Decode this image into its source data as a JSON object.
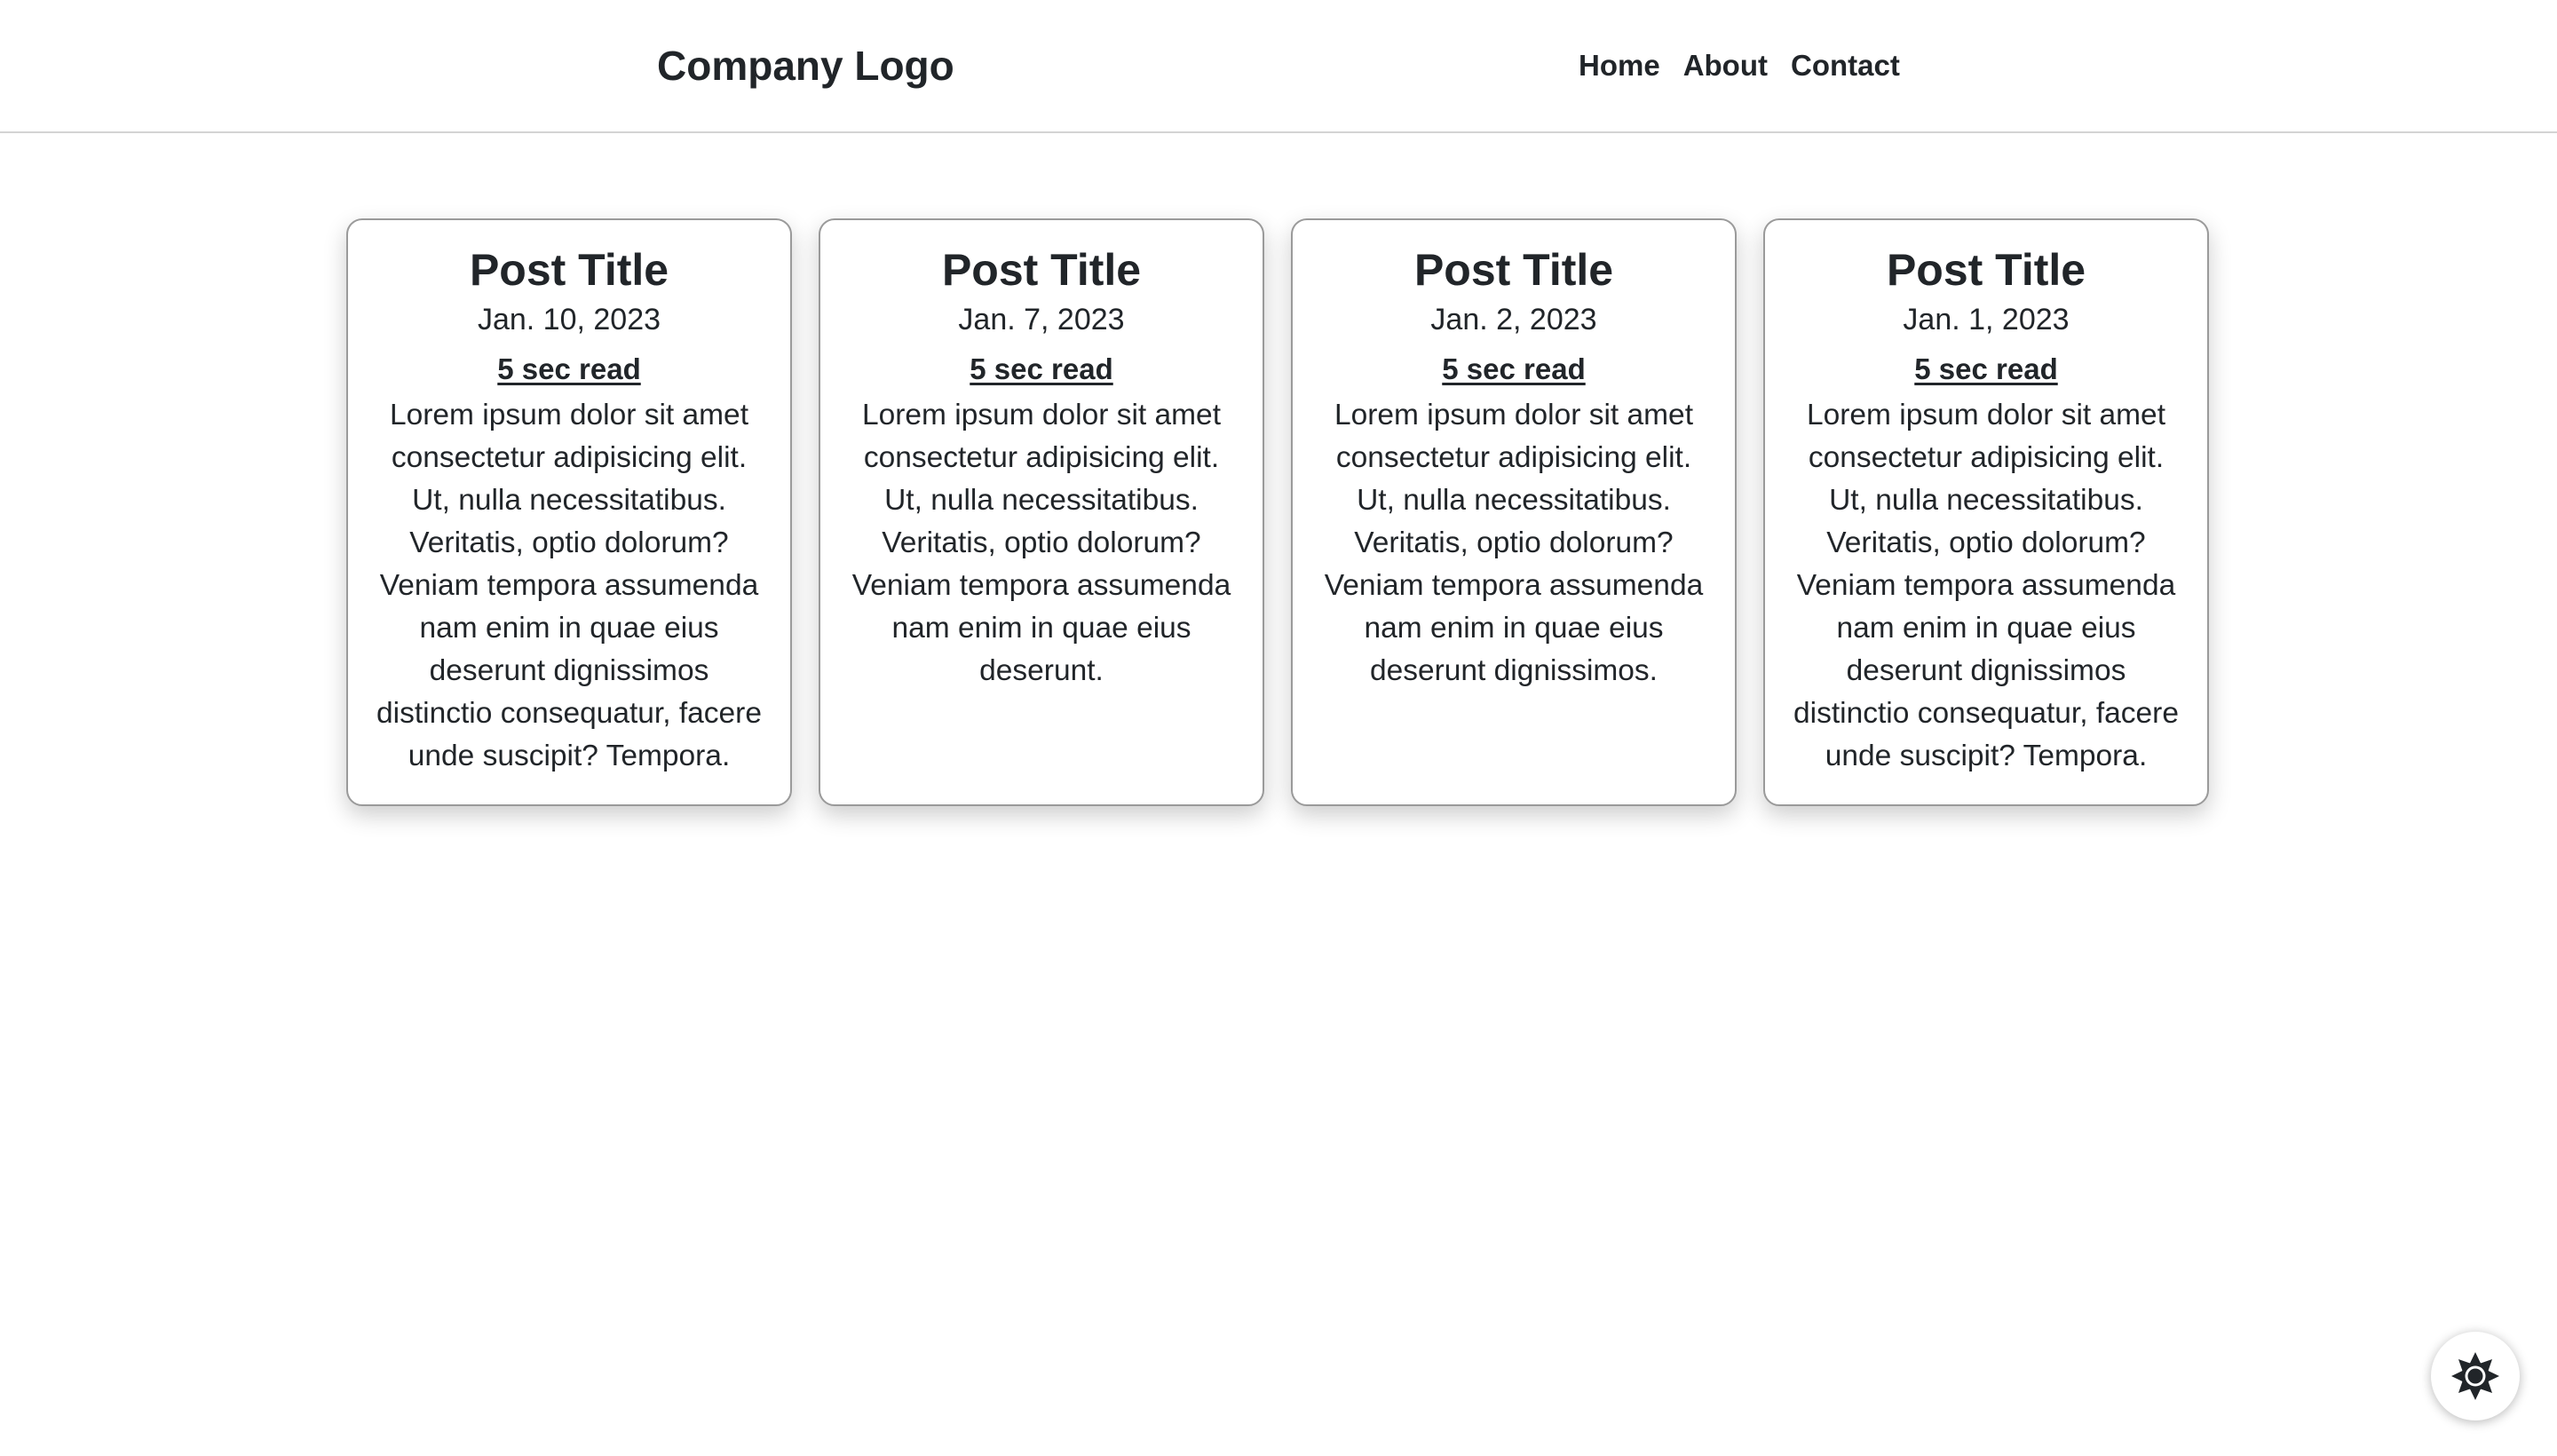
{
  "header": {
    "logo": "Company Logo",
    "nav": [
      "Home",
      "About",
      "Contact"
    ]
  },
  "posts": [
    {
      "title": "Post Title",
      "date": "Jan. 10, 2023",
      "read_time": "5 sec read",
      "excerpt": "Lorem ipsum dolor sit amet consectetur adipisicing elit. Ut, nulla necessitatibus. Veritatis, optio dolorum? Veniam tempora assumenda nam enim in quae eius deserunt dignissimos distinctio consequatur, facere unde suscipit? Tempora."
    },
    {
      "title": "Post Title",
      "date": "Jan. 7, 2023",
      "read_time": "5 sec read",
      "excerpt": "Lorem ipsum dolor sit amet consectetur adipisicing elit. Ut, nulla necessitatibus. Veritatis, optio dolorum? Veniam tempora assumenda nam enim in quae eius deserunt."
    },
    {
      "title": "Post Title",
      "date": "Jan. 2, 2023",
      "read_time": "5 sec read",
      "excerpt": "Lorem ipsum dolor sit amet consectetur adipisicing elit. Ut, nulla necessitatibus. Veritatis, optio dolorum? Veniam tempora assumenda nam enim in quae eius deserunt dignissimos."
    },
    {
      "title": "Post Title",
      "date": "Jan. 1, 2023",
      "read_time": "5 sec read",
      "excerpt": "Lorem ipsum dolor sit amet consectetur adipisicing elit. Ut, nulla necessitatibus. Veritatis, optio dolorum? Veniam tempora assumenda nam enim in quae eius deserunt dignissimos distinctio consequatur, facere unde suscipit? Tempora."
    }
  ],
  "theme_toggle": {
    "icon": "sun-icon"
  },
  "colors": {
    "text": "#212529",
    "background": "#ffffff",
    "card_border": "#9a9a9a",
    "header_divider": "#d4d4d4"
  }
}
